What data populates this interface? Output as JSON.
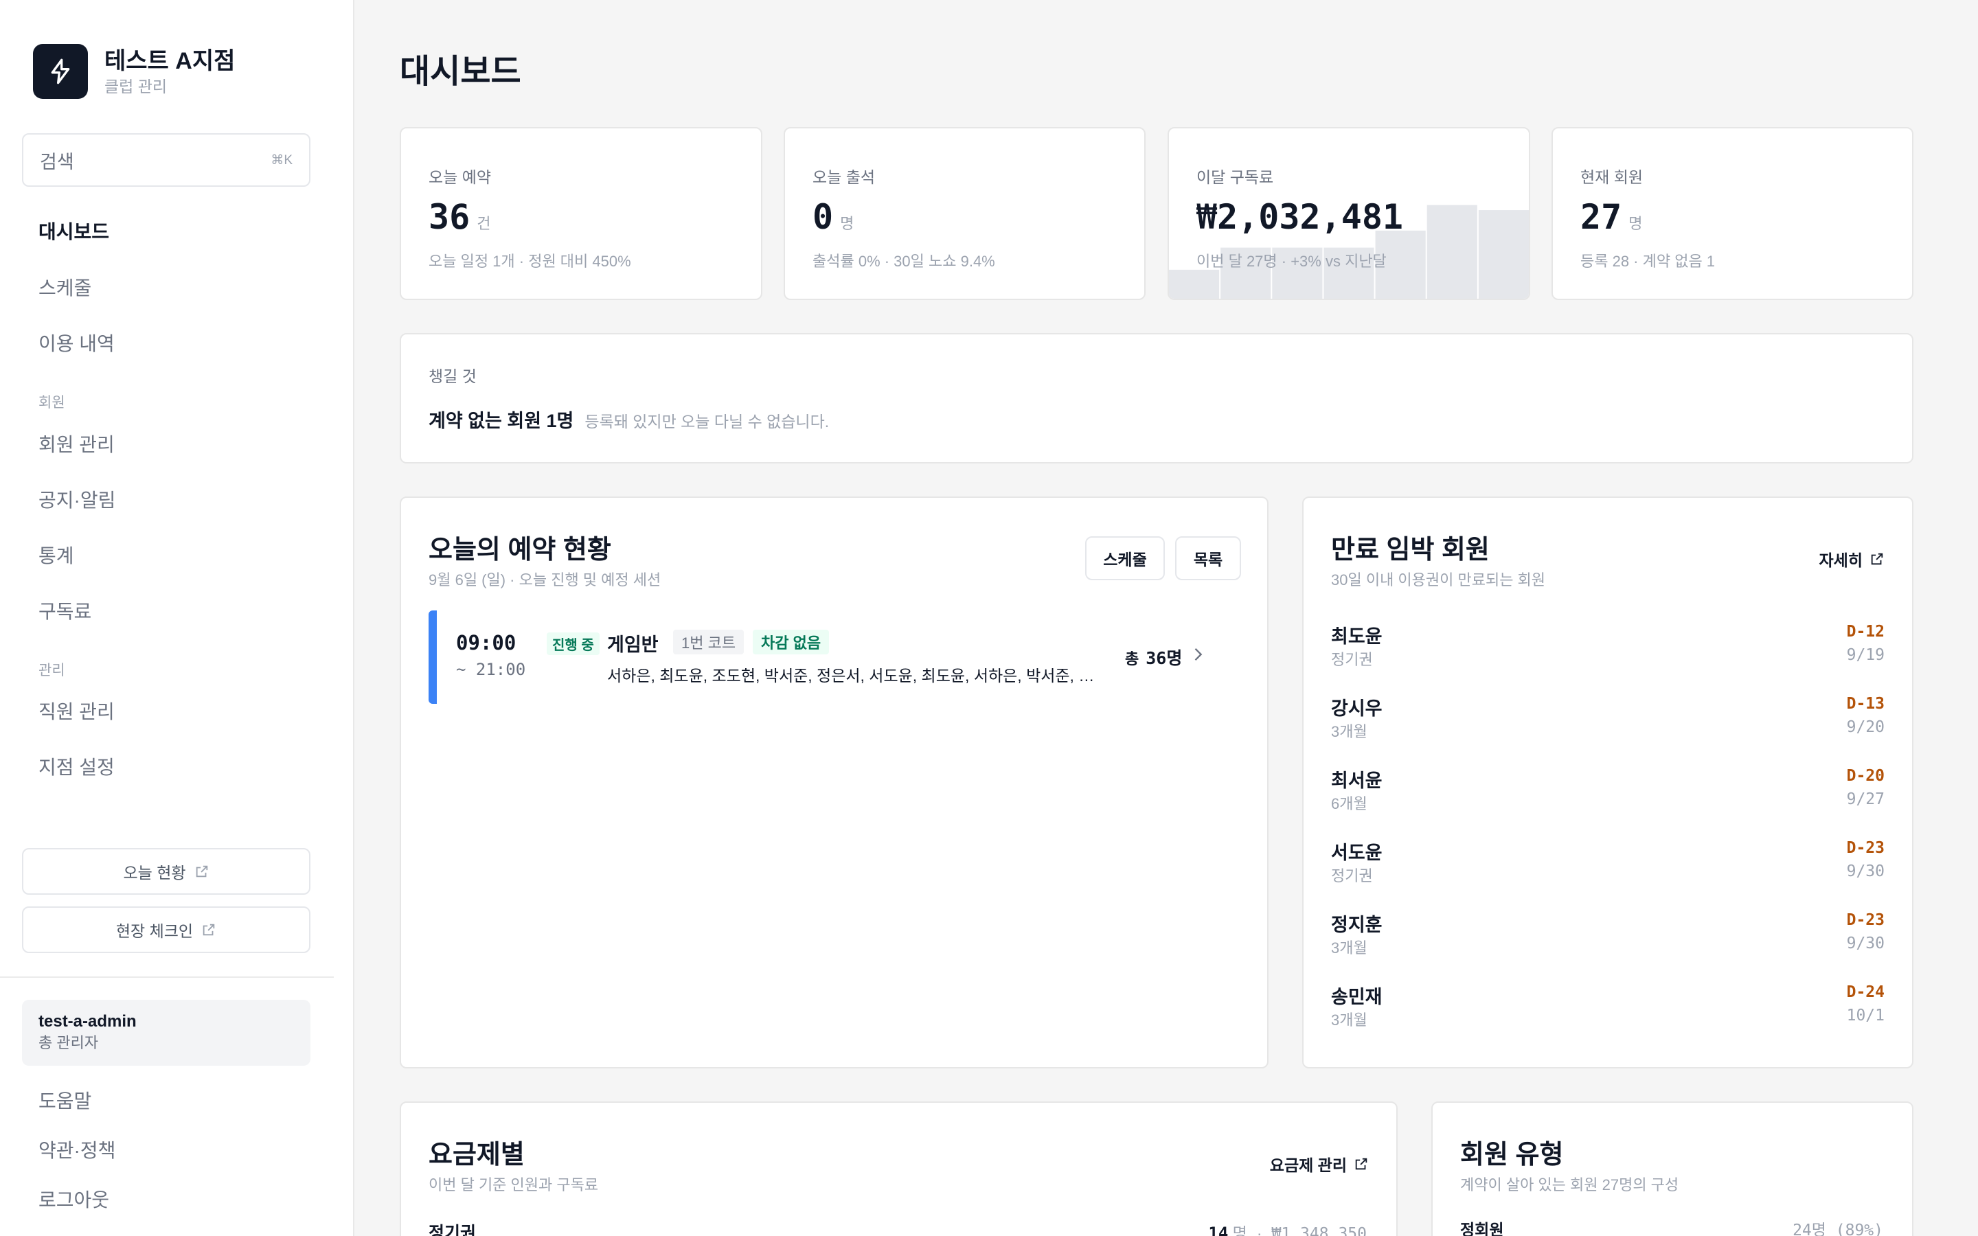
{
  "brand": {
    "name": "테스트 A지점",
    "sub": "클럽 관리"
  },
  "search": {
    "label": "검색",
    "shortcut": "⌘K"
  },
  "nav": {
    "items": [
      {
        "label": "대시보드",
        "active": true
      },
      {
        "label": "스케줄"
      },
      {
        "label": "이용 내역"
      },
      {
        "label": "회원 관리"
      },
      {
        "label": "공지·알림"
      },
      {
        "label": "통계"
      },
      {
        "label": "구독료"
      },
      {
        "label": "직원 관리"
      },
      {
        "label": "지점 설정"
      }
    ],
    "sections": {
      "members": "회원",
      "admin": "관리"
    }
  },
  "side_buttons": {
    "today_status": "오늘 현황",
    "checkin": "현장 체크인"
  },
  "user": {
    "name": "test-a-admin",
    "role": "총 관리자"
  },
  "footer_links": {
    "help": "도움말",
    "terms": "약관·정책",
    "logout": "로그아웃"
  },
  "page": {
    "title": "대시보드"
  },
  "kpis": [
    {
      "label": "오늘 예약",
      "value": "36",
      "unit": "건",
      "sub": "오늘 일정 1개 · 정원 대비 450%"
    },
    {
      "label": "오늘 출석",
      "value": "0",
      "unit": "명",
      "sub": "출석률 0% · 30일 노쇼 9.4%"
    },
    {
      "label": "이달 구독료",
      "value": "₩2,032,481",
      "unit": "",
      "sub": "이번 달 27명 · +3% vs 지난달"
    },
    {
      "label": "현재 회원",
      "value": "27",
      "unit": "명",
      "sub": "등록 28 · 계약 없음 1"
    }
  ],
  "revenue_spark": [
    0.17,
    0.3,
    0.3,
    0.3,
    0.4,
    0.55,
    0.52
  ],
  "todo": {
    "label": "챙길 것",
    "strong": "계약 없는 회원 1명",
    "note": "등록돼 있지만 오늘 다닐 수 없습니다."
  },
  "reservations": {
    "title": "오늘의 예약 현황",
    "subtitle": "9월 6일 (일) · 오늘 진행 및 예정 세션",
    "btn_schedule": "스케줄",
    "btn_list": "목록",
    "session": {
      "start": "09:00",
      "end": "~ 21:00",
      "status": "진행 중",
      "name": "게임반",
      "court": "1번 코트",
      "tag": "차감 없음",
      "members": "서하은, 최도윤, 조도현, 박서준, 정은서, 서도윤, 최도윤, 서하은, 박서준, 서하은, 최도윤",
      "total_label": "총",
      "total": "36명"
    }
  },
  "expiring": {
    "title": "만료 임박 회원",
    "subtitle": "30일 이내 이용권이 만료되는 회원",
    "more": "자세히",
    "rows": [
      {
        "name": "최도윤",
        "plan": "정기권",
        "d": "D-12",
        "date": "9/19"
      },
      {
        "name": "강시우",
        "plan": "3개월",
        "d": "D-13",
        "date": "9/20"
      },
      {
        "name": "최서윤",
        "plan": "6개월",
        "d": "D-20",
        "date": "9/27"
      },
      {
        "name": "서도윤",
        "plan": "정기권",
        "d": "D-23",
        "date": "9/30"
      },
      {
        "name": "정지훈",
        "plan": "3개월",
        "d": "D-23",
        "date": "9/30"
      },
      {
        "name": "송민재",
        "plan": "3개월",
        "d": "D-24",
        "date": "10/1"
      }
    ]
  },
  "plans": {
    "title": "요금제별",
    "subtitle": "이번 달 기준 인원과 구독료",
    "manage": "요금제 관리",
    "rows": [
      {
        "name": "정기권",
        "count": "14",
        "unit": "명",
        "sep": "·",
        "amount": "₩1,348,350"
      }
    ]
  },
  "member_types": {
    "title": "회원 유형",
    "subtitle": "계약이 살아 있는 회원 27명의 구성",
    "rows": [
      {
        "name": "정회원",
        "value": "24명 (89%)",
        "ratio": 0.89
      }
    ]
  }
}
